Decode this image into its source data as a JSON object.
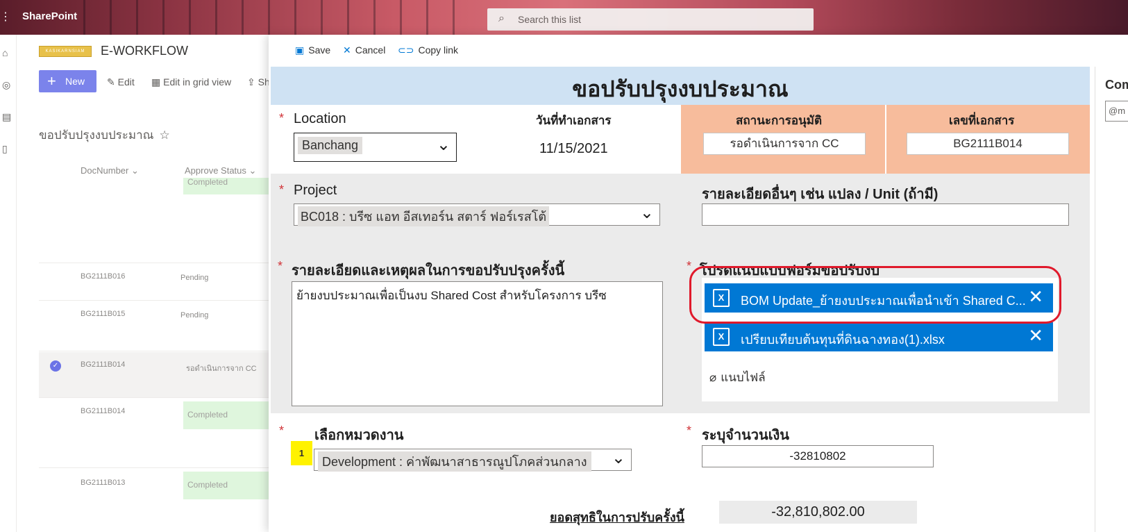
{
  "topbar": {
    "brand": "SharePoint",
    "search_placeholder": "Search this list"
  },
  "site": {
    "logo_text": "KASIKARNSIAM",
    "title": "E-WORKFLOW"
  },
  "commands": {
    "new_label": "New",
    "edit_label": "Edit",
    "grid_label": "Edit in grid view",
    "share_label": "Sh"
  },
  "list": {
    "title": "ขอปรับปรุงงบประมาณ",
    "columns": [
      "DocNumber",
      "Approve Status"
    ],
    "rows": [
      {
        "doc": "",
        "status": "Completed",
        "pill": true
      },
      {
        "doc": "BG2111B016",
        "status": "Pending",
        "pill": false
      },
      {
        "doc": "BG2111B015",
        "status": "Pending",
        "pill": false
      },
      {
        "doc": "BG2111B014",
        "status": "รอดำเนินการจาก CC",
        "pill": false,
        "selected": true
      },
      {
        "doc": "BG2111B014",
        "status": "Completed",
        "pill": true
      },
      {
        "doc": "BG2111B013",
        "status": "Completed",
        "pill": true
      }
    ]
  },
  "panel": {
    "toolbar": {
      "save": "Save",
      "cancel": "Cancel",
      "copy_link": "Copy link"
    },
    "right_label": "Com",
    "right_input": "@m"
  },
  "form": {
    "title": "ขอปรับปรุงงบประมาณ",
    "location": {
      "label": "Location",
      "value": "Banchang"
    },
    "doc_date": {
      "label": "วันที่ทำเอกสาร",
      "value": "11/15/2021"
    },
    "approve_status": {
      "label": "สถานะการอนุมัติ",
      "value": "รอดำเนินการจาก CC"
    },
    "doc_number": {
      "label": "เลขที่เอกสาร",
      "value": "BG2111B014"
    },
    "project": {
      "label": "Project",
      "value": "BC018 : บรีซ แอท อีสเทอร์น สตาร์ ฟอร์เรสโต้"
    },
    "other_detail": {
      "label": "รายละเอียดอื่นๆ เช่น แปลง / Unit (ถ้ามี)",
      "value": ""
    },
    "reason": {
      "label": "รายละเอียดและเหตุผลในการขอปรับปรุงครั้งนี้",
      "value": "ย้ายงบประมาณเพื่อเป็นงบ Shared Cost สำหรับโครงการ บรีซ"
    },
    "attachments": {
      "label": "โปรดแนบแบบฟอร์มขอปรับงบ",
      "files": [
        "BOM Update_ย้ายงบประมาณเพื่อนำเข้า Shared C...",
        "เปรียบเทียบต้นทุนที่ดินฉางทอง(1).xlsx"
      ],
      "attach_label": "แนบไฟล์"
    },
    "category": {
      "label": "เลือกหมวดงาน",
      "value": "Development : ค่าพัฒนาสาธารณูปโภคส่วนกลาง",
      "badge": "1"
    },
    "amount": {
      "label": "ระบุจำนวนเงิน",
      "value": "-32810802"
    },
    "net": {
      "label": "ยอดสุทธิในการปรับครั้งนี้",
      "value": "-32,810,802.00"
    }
  }
}
